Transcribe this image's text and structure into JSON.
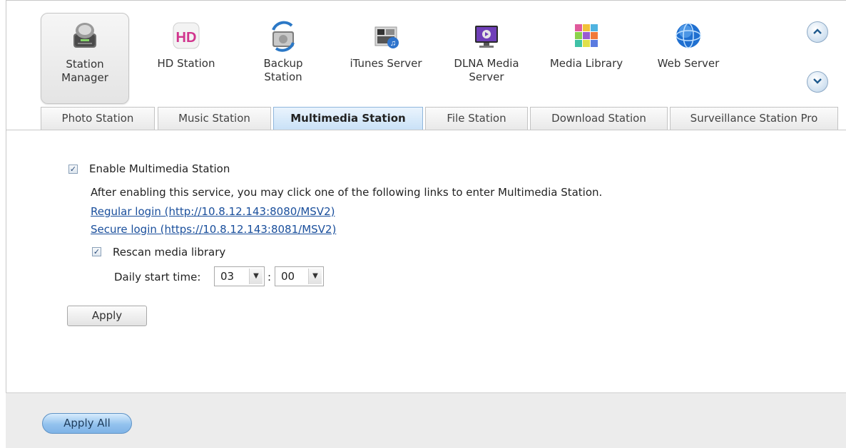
{
  "apps": [
    {
      "label": "Station\nManager",
      "icon": "station-manager-icon",
      "selected": true
    },
    {
      "label": "HD Station",
      "icon": "hd-station-icon",
      "selected": false
    },
    {
      "label": "Backup\nStation",
      "icon": "backup-station-icon",
      "selected": false
    },
    {
      "label": "iTunes Server",
      "icon": "itunes-server-icon",
      "selected": false
    },
    {
      "label": "DLNA Media\nServer",
      "icon": "dlna-media-server-icon",
      "selected": false
    },
    {
      "label": "Media Library",
      "icon": "media-library-icon",
      "selected": false
    },
    {
      "label": "Web Server",
      "icon": "web-server-icon",
      "selected": false
    }
  ],
  "scroll": {
    "up_icon": "chevron-up-icon",
    "down_icon": "chevron-down-icon"
  },
  "tabs": [
    {
      "label": "Photo Station",
      "active": false
    },
    {
      "label": "Music Station",
      "active": false
    },
    {
      "label": "Multimedia Station",
      "active": true
    },
    {
      "label": "File Station",
      "active": false
    },
    {
      "label": "Download Station",
      "active": false
    },
    {
      "label": "Surveillance Station Pro",
      "active": false
    }
  ],
  "content": {
    "enable_label": "Enable Multimedia Station",
    "enable_checked": true,
    "description": "After enabling this service, you may click one of the following links to enter Multimedia Station.",
    "regular_login": "Regular login (http://10.8.12.143:8080/MSV2)",
    "secure_login": "Secure login (https://10.8.12.143:8081/MSV2)",
    "rescan_label": "Rescan media library",
    "rescan_checked": true,
    "daily_start_label": "Daily start time:",
    "hour": "03",
    "minute": "00",
    "time_separator": ":",
    "apply_label": "Apply"
  },
  "footer": {
    "apply_all_label": "Apply All"
  },
  "colors": {
    "accent": "#c9e1f7",
    "link": "#1a4f9c",
    "footer_bg": "#ececec"
  }
}
